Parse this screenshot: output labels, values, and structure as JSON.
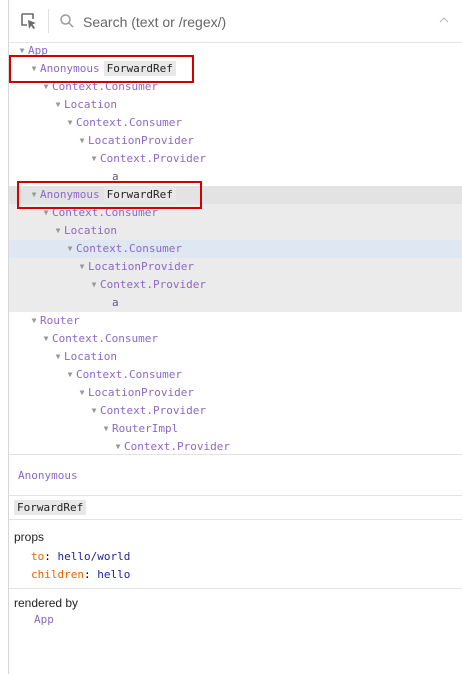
{
  "search": {
    "placeholder": "Search (text or /regex/)"
  },
  "tree": {
    "rows": [
      {
        "label": "App",
        "badge": ""
      },
      {
        "label": "Anonymous",
        "badge": "ForwardRef"
      },
      {
        "label": "Context.Consumer",
        "badge": ""
      },
      {
        "label": "Location",
        "badge": ""
      },
      {
        "label": "Context.Consumer",
        "badge": ""
      },
      {
        "label": "LocationProvider",
        "badge": ""
      },
      {
        "label": "Context.Provider",
        "badge": ""
      },
      {
        "label": "a",
        "badge": ""
      },
      {
        "label": "Anonymous",
        "badge": "ForwardRef"
      },
      {
        "label": "Context.Consumer",
        "badge": ""
      },
      {
        "label": "Location",
        "badge": ""
      },
      {
        "label": "Context.Consumer",
        "badge": ""
      },
      {
        "label": "LocationProvider",
        "badge": ""
      },
      {
        "label": "Context.Provider",
        "badge": ""
      },
      {
        "label": "a",
        "badge": ""
      },
      {
        "label": "Router",
        "badge": ""
      },
      {
        "label": "Context.Consumer",
        "badge": ""
      },
      {
        "label": "Location",
        "badge": ""
      },
      {
        "label": "Context.Consumer",
        "badge": ""
      },
      {
        "label": "LocationProvider",
        "badge": ""
      },
      {
        "label": "Context.Provider",
        "badge": ""
      },
      {
        "label": "RouterImpl",
        "badge": ""
      },
      {
        "label": "Context.Provider",
        "badge": ""
      }
    ]
  },
  "details": {
    "component_name": "Anonymous",
    "badge": "ForwardRef",
    "props_label": "props",
    "props": [
      {
        "key": "to",
        "value": "hello/world"
      },
      {
        "key": "children",
        "value": "hello"
      }
    ],
    "rendered_by_label": "rendered by",
    "rendered_by": "App"
  }
}
